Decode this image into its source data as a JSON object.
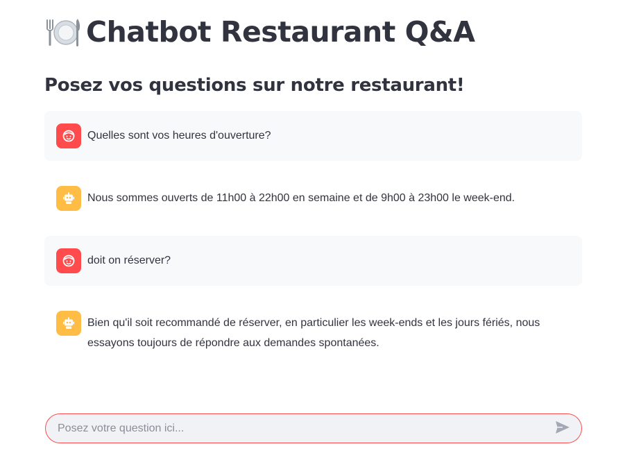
{
  "header": {
    "title": "Chatbot Restaurant Q&A",
    "title_icon": "plate-with-cutlery-icon"
  },
  "subheader": "Posez vos questions sur notre restaurant!",
  "messages": [
    {
      "role": "user",
      "avatar_icon": "user-face-icon",
      "text": "Quelles sont vos heures d'ouverture?"
    },
    {
      "role": "assistant",
      "avatar_icon": "robot-icon",
      "text": "Nous sommes ouverts de 11h00 à 22h00 en semaine et de 9h00 à 23h00 le week-end."
    },
    {
      "role": "user",
      "avatar_icon": "user-face-icon",
      "text": "doit on réserver?"
    },
    {
      "role": "assistant",
      "avatar_icon": "robot-icon",
      "text": "Bien qu'il soit recommandé de réserver, en particulier les week-ends et les jours fériés, nous essayons toujours de répondre aux demandes spontanées."
    }
  ],
  "chat_input": {
    "placeholder": "Posez votre question ici...",
    "value": "",
    "send_icon": "send-icon"
  },
  "colors": {
    "user_avatar": "#ff4b4b",
    "assistant_avatar": "#ffbd45",
    "user_message_bg": "#f8f9fb",
    "input_border": "#ff4b4b",
    "input_bg": "#f0f2f6",
    "text": "#31333f"
  }
}
